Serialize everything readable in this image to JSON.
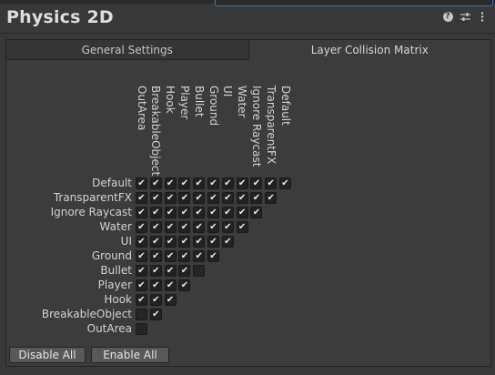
{
  "header": {
    "title": "Physics 2D"
  },
  "tabs": [
    {
      "label": "General Settings",
      "active": false
    },
    {
      "label": "Layer Collision Matrix",
      "active": true
    }
  ],
  "matrix": {
    "columns": [
      "OutArea",
      "BreakableObject",
      "Hook",
      "Player",
      "Bullet",
      "Ground",
      "UI",
      "Water",
      "Ignore Raycast",
      "TransparentFX",
      "Default"
    ],
    "rows": [
      {
        "label": "Default",
        "checks": [
          true,
          true,
          true,
          true,
          true,
          true,
          true,
          true,
          true,
          true,
          true
        ]
      },
      {
        "label": "TransparentFX",
        "checks": [
          true,
          true,
          true,
          true,
          true,
          true,
          true,
          true,
          true,
          true
        ]
      },
      {
        "label": "Ignore Raycast",
        "checks": [
          true,
          true,
          true,
          true,
          true,
          true,
          true,
          true,
          true
        ]
      },
      {
        "label": "Water",
        "checks": [
          true,
          true,
          true,
          true,
          true,
          true,
          true,
          true
        ]
      },
      {
        "label": "UI",
        "checks": [
          true,
          true,
          true,
          true,
          true,
          true,
          true
        ]
      },
      {
        "label": "Ground",
        "checks": [
          true,
          true,
          true,
          true,
          true,
          true
        ]
      },
      {
        "label": "Bullet",
        "checks": [
          true,
          true,
          true,
          true,
          false
        ]
      },
      {
        "label": "Player",
        "checks": [
          true,
          true,
          true,
          true
        ]
      },
      {
        "label": "Hook",
        "checks": [
          true,
          true,
          true
        ]
      },
      {
        "label": "BreakableObject",
        "checks": [
          false,
          true
        ]
      },
      {
        "label": "OutArea",
        "checks": [
          false
        ]
      }
    ]
  },
  "buttons": {
    "disable_all": "Disable All",
    "enable_all": "Enable All"
  },
  "colors": {
    "background": "#383838",
    "panel": "#3c3c3c",
    "accent": "#3b74b8"
  }
}
